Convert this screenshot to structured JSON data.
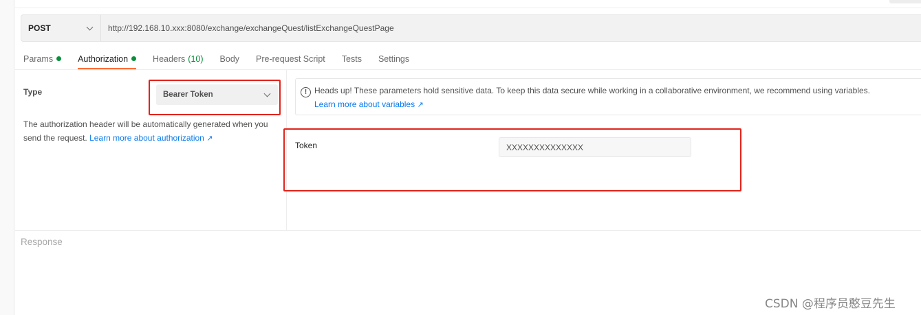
{
  "request": {
    "method": "POST",
    "url": "http://192.168.10.xxx:8080/exchange/exchangeQuest/listExchangeQuestPage"
  },
  "tabs": [
    {
      "label": "Params",
      "dot": true
    },
    {
      "label": "Authorization",
      "dot": true,
      "active": true
    },
    {
      "label": "Headers",
      "count": "(10)"
    },
    {
      "label": "Body"
    },
    {
      "label": "Pre-request Script"
    },
    {
      "label": "Tests"
    },
    {
      "label": "Settings"
    }
  ],
  "auth": {
    "type_label": "Type",
    "type_value": "Bearer Token",
    "description": "The authorization header will be automatically generated when you send the request.",
    "learn_more": "Learn more about authorization",
    "notice_text": "Heads up! These parameters hold sensitive data. To keep this data secure while working in a collaborative environment, we recommend using variables.",
    "notice_link": "Learn more about variables",
    "token_label": "Token",
    "token_value": "XXXXXXXXXXXXXX"
  },
  "response": {
    "label": "Response"
  },
  "watermark": "CSDN @程序员憨豆先生",
  "colors": {
    "accent": "#ff6c37",
    "highlight_box": "#e2231a",
    "status_dot": "#0a8f3c",
    "link": "#097bed"
  }
}
